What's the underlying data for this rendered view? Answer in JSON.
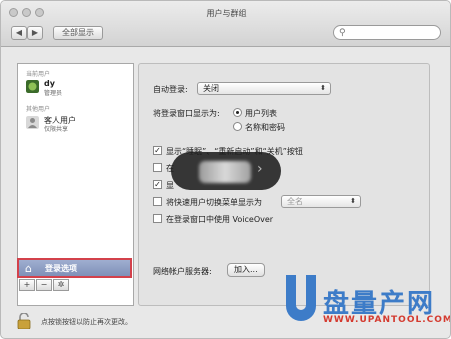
{
  "window": {
    "title": "用户与群组"
  },
  "toolbar": {
    "back": "◀",
    "forward": "▶",
    "show_all": "全部显示",
    "search_placeholder": ""
  },
  "sidebar": {
    "current_users_label": "当前用户",
    "current_user": {
      "name": "dy",
      "role": "管理员"
    },
    "other_users_label": "其他用户",
    "guest_user": {
      "name": "客人用户",
      "role": "仅限共享"
    },
    "login_options_label": "登录选项",
    "add_btn": "+",
    "remove_btn": "−",
    "settings_btn": "✲"
  },
  "panel": {
    "auto_login_label": "自动登录:",
    "auto_login_value": "关闭",
    "display_as_label": "将登录窗口显示为:",
    "radio_list": "用户列表",
    "radio_name_pw": "名称和密码",
    "cb_show_buttons": "显示“睡眠”、“重新启动”和“关机”按钮",
    "cb_show_buttons_checked": true,
    "cb_row2_prefix": "在",
    "cb_row3_prefix": "显",
    "cb_fast_switch": "将快速用户切换菜单显示为",
    "fast_switch_value": "全名",
    "cb_voiceover": "在登录窗口中使用 VoiceOver",
    "network_server_label": "网络帐户服务器:",
    "join_button": "加入..."
  },
  "footer": {
    "lock_text": "点按锁按钮以防止再次更改。"
  },
  "watermark": {
    "name": "盘量产网",
    "url": "WWW.UPANTOOL.COM"
  },
  "colors": {
    "selection": "#8c9cc4",
    "highlight_border": "#d3414b",
    "brand_blue": "#3d7cc8",
    "brand_red": "#d43a2f"
  }
}
